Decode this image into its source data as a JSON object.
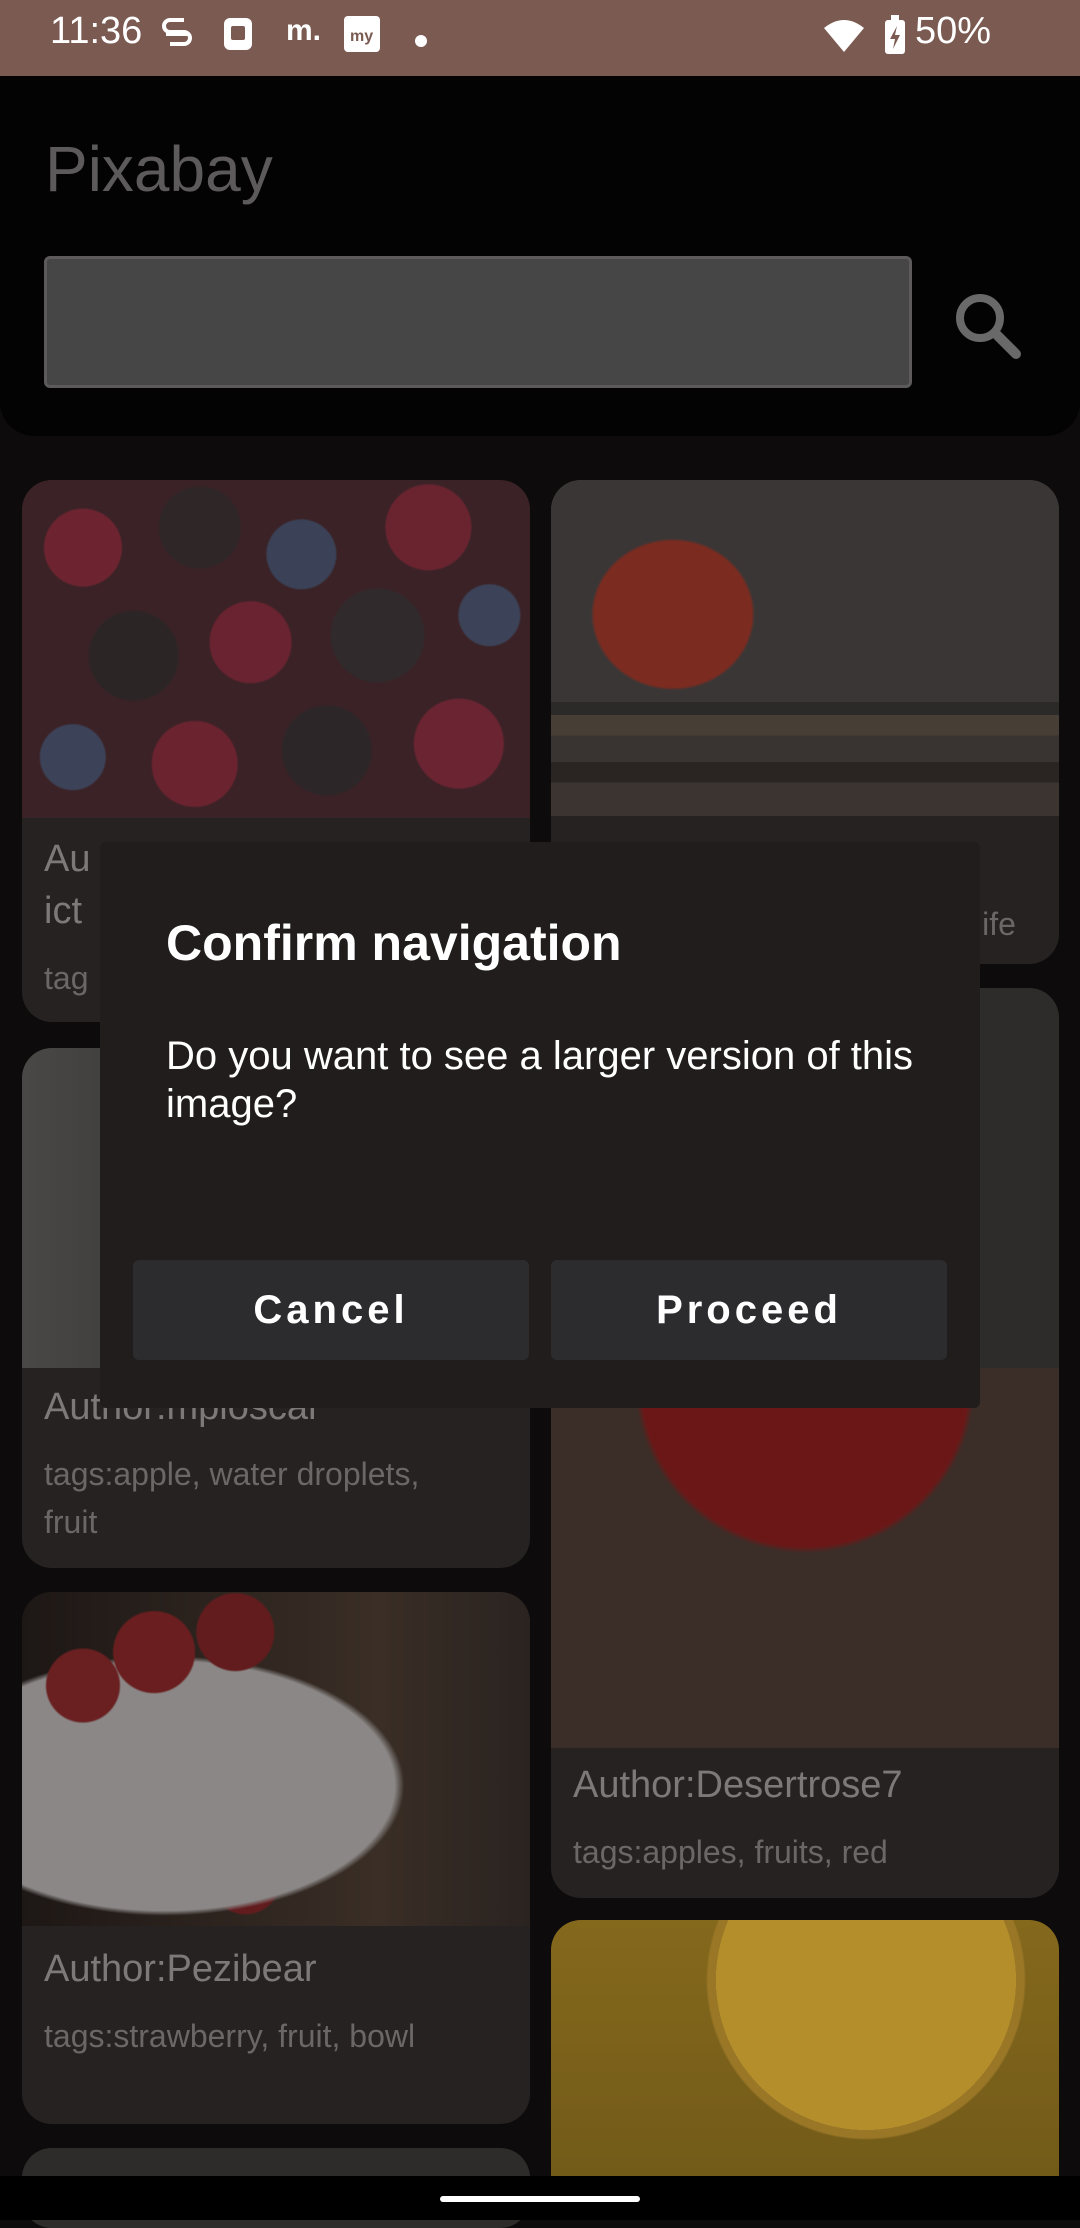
{
  "status_bar": {
    "time": "11:36",
    "notification_icons": [
      "sim-icon",
      "fitness-icon",
      "m.",
      "my-app-icon",
      "dot"
    ],
    "battery_percent": "50%"
  },
  "app": {
    "title": "Pixabay",
    "search": {
      "value": "",
      "placeholder": ""
    }
  },
  "cards": [
    {
      "author": "Au",
      "author_line2": "ict",
      "tags": "tag"
    },
    {
      "author": "",
      "tags": "life"
    },
    {
      "author": "Author:mploscar",
      "tags": "tags:apple, water droplets, fruit"
    },
    {
      "author": "Author:Desertrose7",
      "tags": "tags:apples, fruits, red"
    },
    {
      "author": "Author:Pezibear",
      "tags": "tags:strawberry, fruit, bowl"
    }
  ],
  "dialog": {
    "title": "Confirm navigation",
    "message": "Do you want to see a larger version of this image?",
    "cancel_label": "Cancel",
    "proceed_label": "Proceed"
  },
  "colors": {
    "status_bar": "#7a5a51",
    "background": "#0d0b0b",
    "card": "#262221",
    "dialog": "#201d1c",
    "dialog_button": "#2c2b2e"
  }
}
